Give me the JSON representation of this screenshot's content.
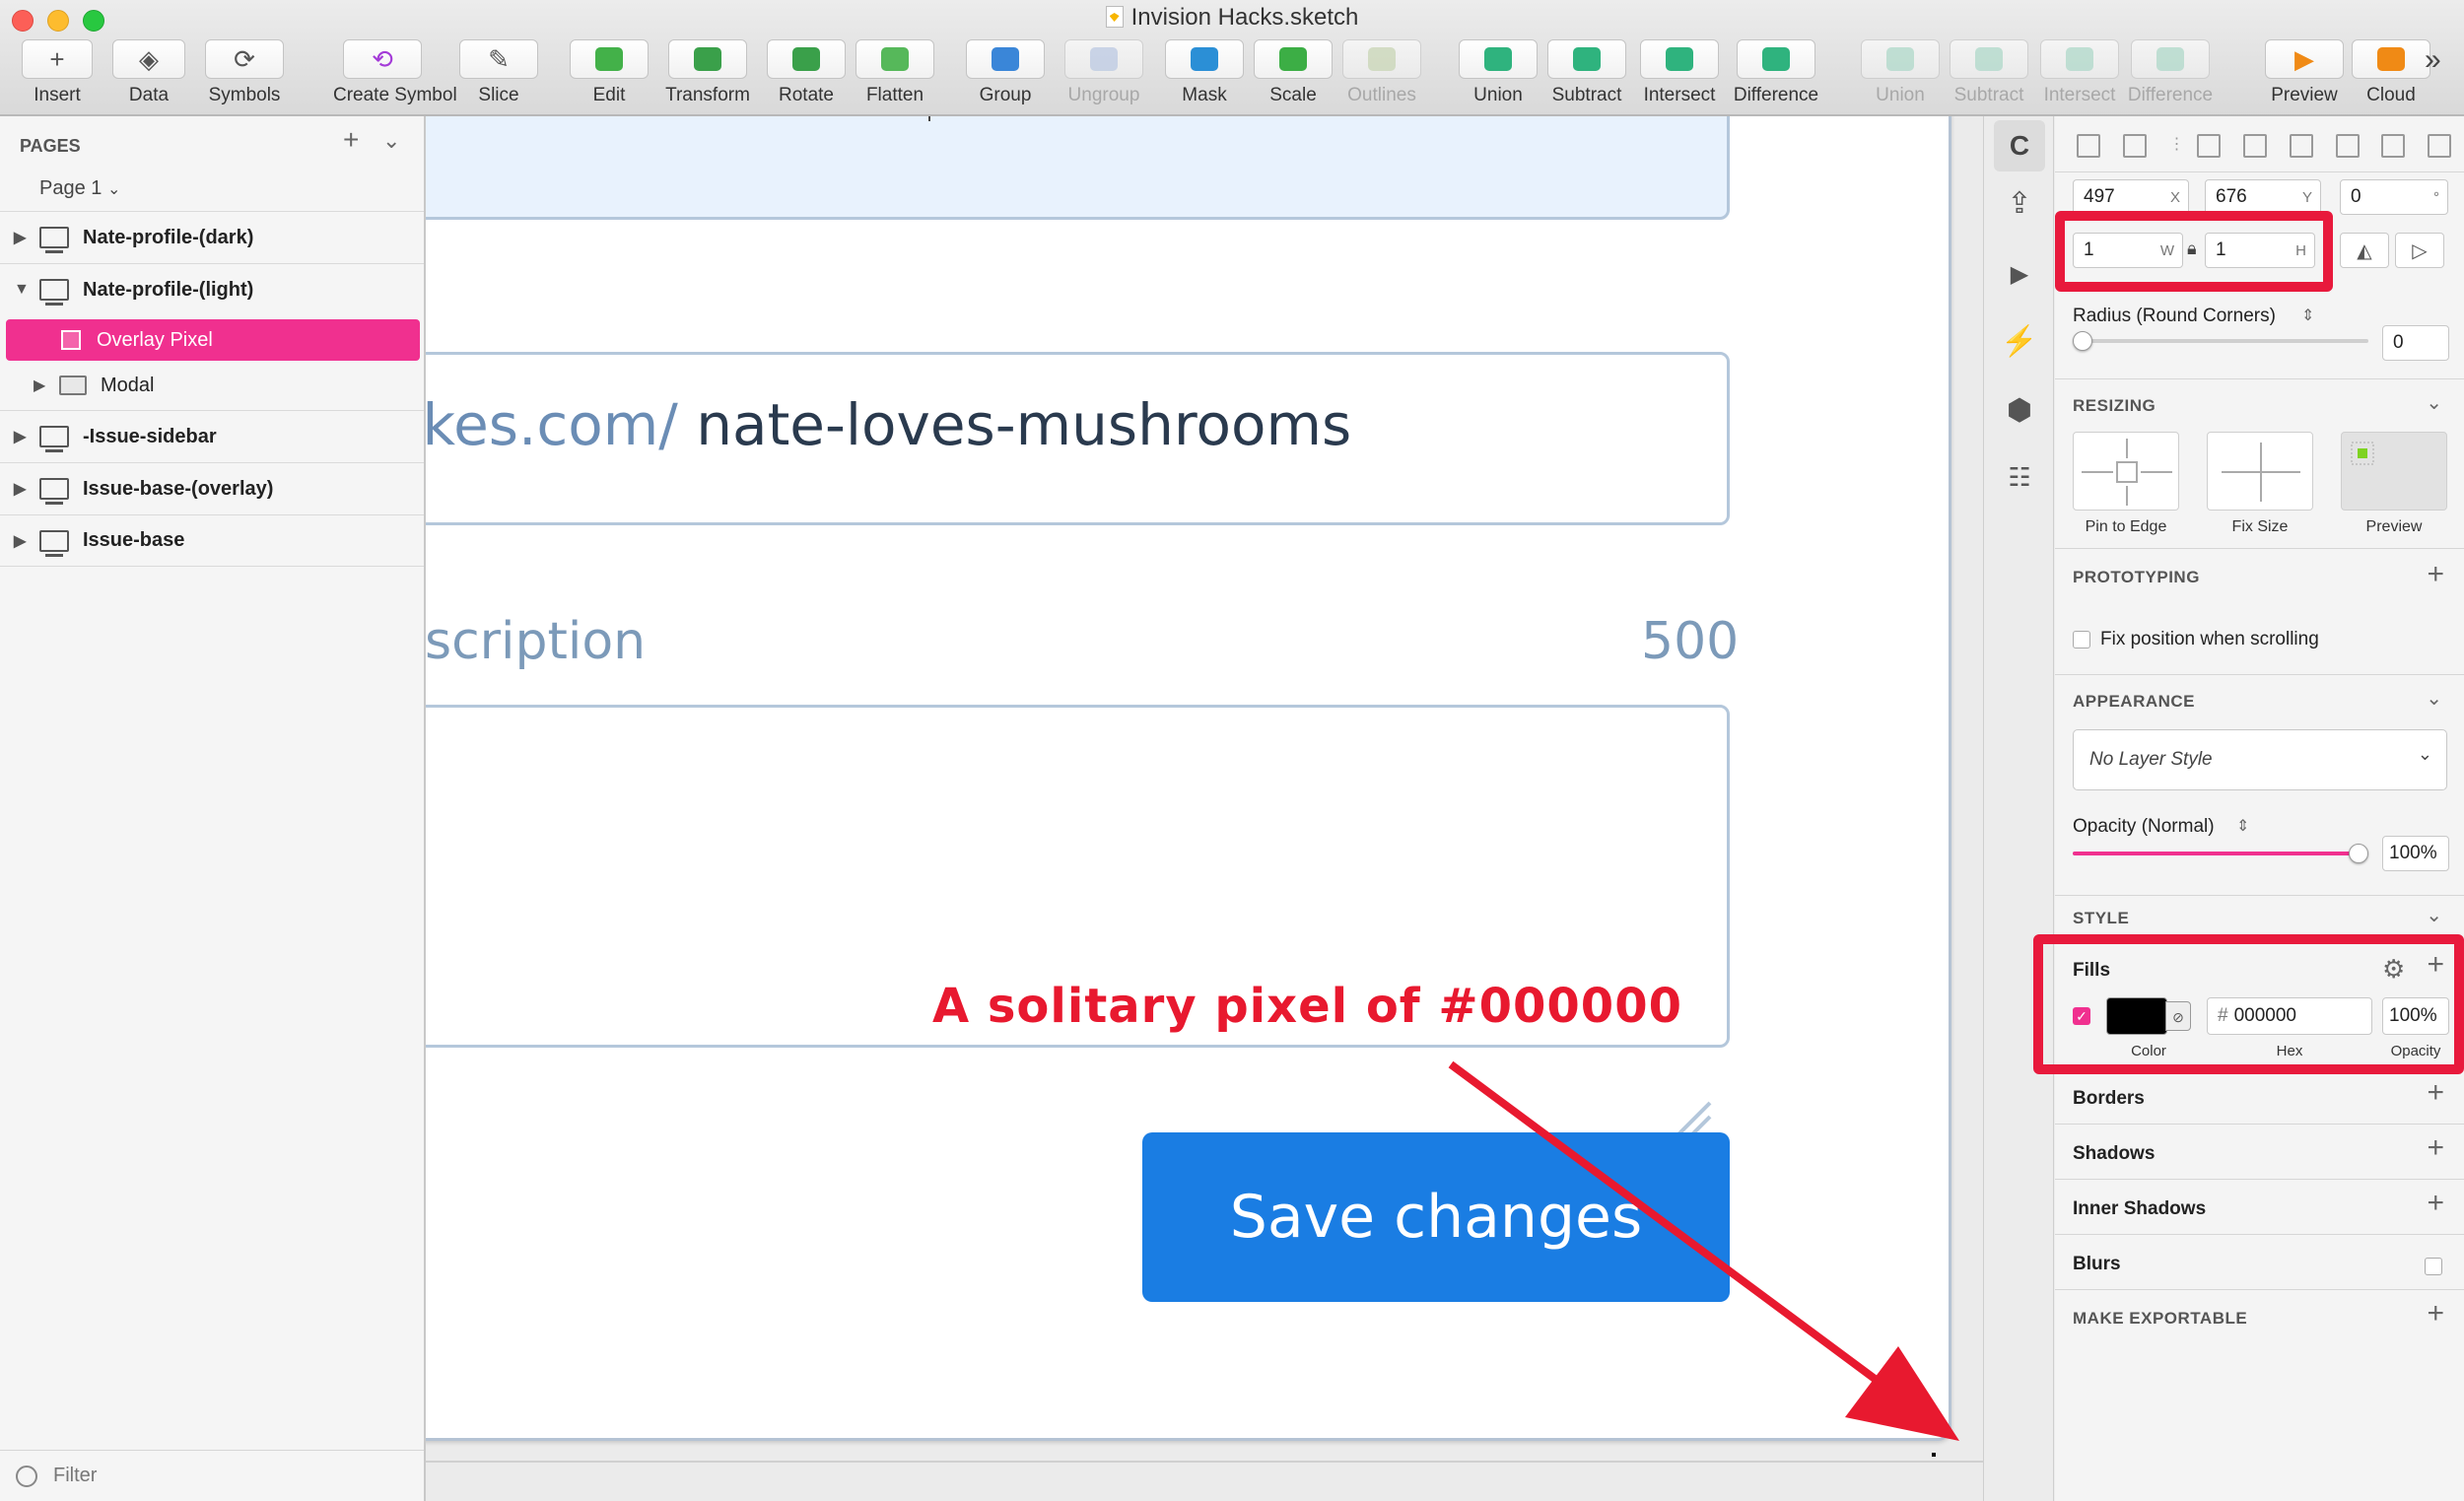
{
  "window": {
    "title": "Invision Hacks.sketch"
  },
  "toolbar": {
    "items": [
      {
        "label": "Insert",
        "glyph": "+"
      },
      {
        "label": "Data",
        "glyph": "◈"
      },
      {
        "label": "Symbols",
        "glyph": "⟳"
      },
      {
        "label": "Create Symbol",
        "glyph": "⟲"
      },
      {
        "label": "Slice",
        "glyph": "✎"
      },
      {
        "label": "Edit",
        "glyph": ""
      },
      {
        "label": "Transform",
        "glyph": ""
      },
      {
        "label": "Rotate",
        "glyph": ""
      },
      {
        "label": "Flatten",
        "glyph": ""
      },
      {
        "label": "Group",
        "glyph": ""
      },
      {
        "label": "Ungroup",
        "glyph": ""
      },
      {
        "label": "Mask",
        "glyph": ""
      },
      {
        "label": "Scale",
        "glyph": ""
      },
      {
        "label": "Outlines",
        "glyph": ""
      },
      {
        "label": "Union",
        "glyph": ""
      },
      {
        "label": "Subtract",
        "glyph": ""
      },
      {
        "label": "Intersect",
        "glyph": ""
      },
      {
        "label": "Difference",
        "glyph": ""
      },
      {
        "label": "Union",
        "glyph": ""
      },
      {
        "label": "Subtract",
        "glyph": ""
      },
      {
        "label": "Intersect",
        "glyph": ""
      },
      {
        "label": "Difference",
        "glyph": ""
      },
      {
        "label": "Preview",
        "glyph": "▶"
      },
      {
        "label": "Cloud",
        "glyph": ""
      }
    ],
    "overflow": "»"
  },
  "sidebar": {
    "pages_header": "PAGES",
    "current_page": "Page 1",
    "layers": [
      {
        "name": "Nate-profile-(dark)",
        "expanded": false
      },
      {
        "name": "Nate-profile-(light)",
        "expanded": true
      },
      {
        "name": "-Issue-sidebar",
        "expanded": false
      },
      {
        "name": "Issue-base-(overlay)",
        "expanded": false
      },
      {
        "name": "Issue-base",
        "expanded": false
      }
    ],
    "selected_layer": "Overlay Pixel",
    "child_group": "Modal",
    "filter_placeholder": "Filter"
  },
  "canvas": {
    "url_prefix": "akes.com/",
    "url_slug": "nate-loves-mushrooms",
    "description_label": "escription",
    "description_count": "500",
    "annotation": "A solitary pixel of #000000",
    "save_button": "Save changes",
    "annotation_color": "#e8192f",
    "button_color": "#1a7de3"
  },
  "inspector": {
    "x": "497",
    "x_suffix": "X",
    "y": "676",
    "y_suffix": "Y",
    "rotation": "0",
    "rotation_suffix": "°",
    "w": "1",
    "w_suffix": "W",
    "h": "1",
    "h_suffix": "H",
    "radius_label": "Radius (Round Corners)",
    "radius_value": "0",
    "radius_level": 0,
    "resizing_header": "RESIZING",
    "resize_options": [
      "Pin to Edge",
      "Fix Size",
      "Preview"
    ],
    "prototyping_header": "PROTOTYPING",
    "fix_position_label": "Fix position when scrolling",
    "fix_position_checked": false,
    "appearance_header": "APPEARANCE",
    "layer_style": "No Layer Style",
    "opacity_label": "Opacity (Normal)",
    "opacity_value": "100%",
    "opacity_level": 1.0,
    "style_header": "STYLE",
    "fills_label": "Fills",
    "fill_enabled": true,
    "fill_color": "#000000",
    "fill_hex": "000000",
    "fill_hex_prefix": "#",
    "fill_opacity": "100%",
    "fill_sublabels": {
      "color": "Color",
      "hex": "Hex",
      "opacity": "Opacity"
    },
    "borders_label": "Borders",
    "shadows_label": "Shadows",
    "inner_shadows_label": "Inner Shadows",
    "blurs_label": "Blurs",
    "exportable_header": "MAKE EXPORTABLE",
    "highlight_color": "#e8193c",
    "accent_color": "#f0308f"
  }
}
